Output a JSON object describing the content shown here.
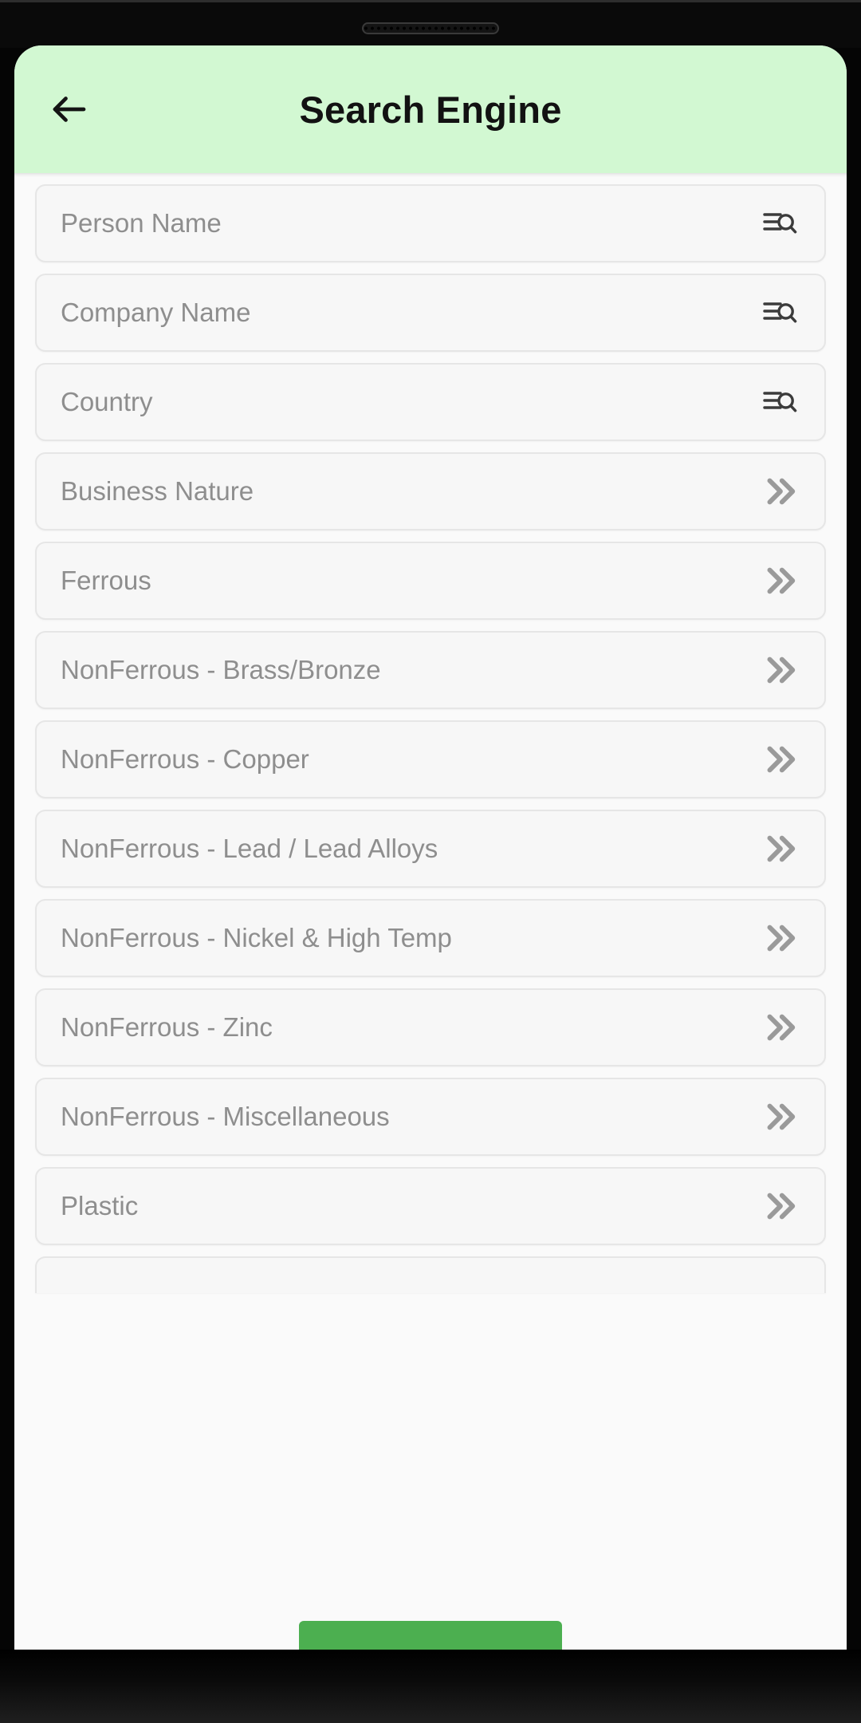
{
  "appbar": {
    "title": "Search Engine",
    "back_icon": "arrow-left-icon",
    "background_color": "#d2f8d2"
  },
  "search_fields": [
    {
      "placeholder": "Person Name",
      "icon": "filter-search-icon"
    },
    {
      "placeholder": "Company Name",
      "icon": "filter-search-icon"
    },
    {
      "placeholder": "Country",
      "icon": "filter-search-icon"
    }
  ],
  "category_rows": [
    {
      "label": "Business Nature",
      "icon": "double-chevron-right-icon"
    },
    {
      "label": "Ferrous",
      "icon": "double-chevron-right-icon"
    },
    {
      "label": "NonFerrous - Brass/Bronze",
      "icon": "double-chevron-right-icon"
    },
    {
      "label": "NonFerrous - Copper",
      "icon": "double-chevron-right-icon"
    },
    {
      "label": "NonFerrous - Lead / Lead Alloys",
      "icon": "double-chevron-right-icon"
    },
    {
      "label": "NonFerrous - Nickel & High Temp",
      "icon": "double-chevron-right-icon"
    },
    {
      "label": "NonFerrous - Zinc",
      "icon": "double-chevron-right-icon"
    },
    {
      "label": "NonFerrous - Miscellaneous",
      "icon": "double-chevron-right-icon"
    },
    {
      "label": "Plastic",
      "icon": "double-chevron-right-icon"
    }
  ],
  "action_button": {
    "label": "",
    "color": "#4caf50"
  },
  "colors": {
    "appbar_green": "#d2f8d2",
    "button_green": "#4caf50",
    "field_background": "#f7f7f7",
    "field_border": "#e6e6e6",
    "placeholder_text": "#8e8e8e",
    "screen_background": "#fafafa"
  }
}
